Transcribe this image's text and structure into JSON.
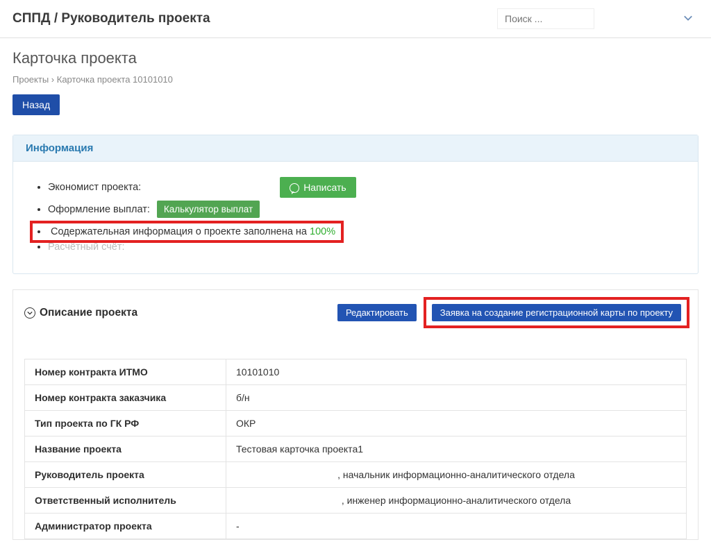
{
  "header": {
    "app_title": "СППД / Руководитель проекта",
    "search_placeholder": "Поиск ..."
  },
  "page": {
    "title": "Карточка проекта",
    "breadcrumb_root": "Проекты",
    "breadcrumb_current": "Карточка проекта 10101010",
    "back_label": "Назад"
  },
  "info_panel": {
    "title": "Информация",
    "economist_label": "Экономист проекта:",
    "write_label": "Написать",
    "payments_label": "Оформление выплат:",
    "calculator_label": "Калькулятор выплат",
    "content_completion_prefix": "Содержательная информация о проекте заполнена на ",
    "content_completion_value": "100%",
    "account_label": "Расчётный счёт:"
  },
  "description_section": {
    "title": "Описание проекта",
    "edit_label": "Редактировать",
    "registration_request_label": "Заявка на создание регистрационной карты по проекту"
  },
  "description_rows": [
    {
      "key": "Номер контракта ИТМО",
      "value": "10101010"
    },
    {
      "key": "Номер контракта заказчика",
      "value": "б/н"
    },
    {
      "key": "Тип проекта по ГК РФ",
      "value": "ОКР"
    },
    {
      "key": "Название проекта",
      "value": "Тестовая карточка проекта1"
    },
    {
      "key": "Руководитель проекта",
      "value": ", начальник информационно-аналитического отдела"
    },
    {
      "key": "Ответственный исполнитель",
      "value": ", инженер информационно-аналитического отдела"
    },
    {
      "key": "Администратор проекта",
      "value": "-"
    }
  ]
}
